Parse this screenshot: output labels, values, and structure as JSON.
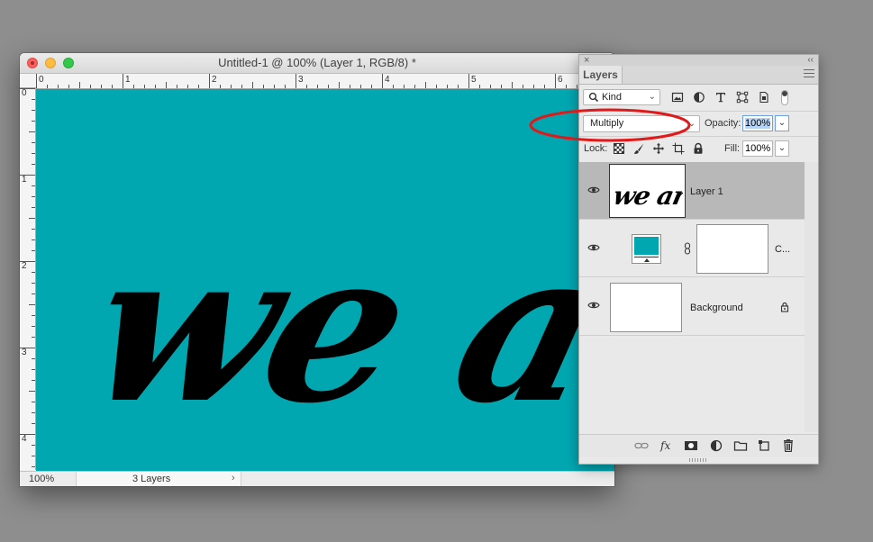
{
  "document": {
    "title": "Untitled-1 @ 100% (Layer 1, RGB/8) *",
    "canvas_color": "#00a7b1",
    "canvas_text": "we are",
    "ruler_h_ticks": [
      "0",
      "1",
      "2",
      "3",
      "4",
      "5",
      "6"
    ],
    "ruler_v_ticks": [
      "0",
      "1",
      "2",
      "3",
      "4"
    ],
    "status": {
      "zoom": "100%",
      "info": "3 Layers",
      "arrow": "›"
    }
  },
  "panel": {
    "close_glyph": "×",
    "collapse_glyph": "‹‹",
    "tab": "Layers",
    "filter": {
      "kind": "Kind",
      "chevron": "⌄"
    },
    "blend": {
      "mode": "Multiply",
      "chevron": "⌄"
    },
    "opacity": {
      "label": "Opacity:",
      "value": "100%"
    },
    "lock": {
      "label": "Lock:"
    },
    "fill": {
      "label": "Fill:",
      "value": "100%"
    },
    "dropdown_glyph": "⌄",
    "layers": [
      {
        "name": "Layer 1",
        "thumb_text": "we are",
        "selected": true
      },
      {
        "name": "C...",
        "type": "fill-adjustment",
        "swatch_color": "#00a7b1"
      },
      {
        "name": "Background",
        "locked": true
      }
    ]
  },
  "annotation": {
    "color": "#e0191b"
  }
}
